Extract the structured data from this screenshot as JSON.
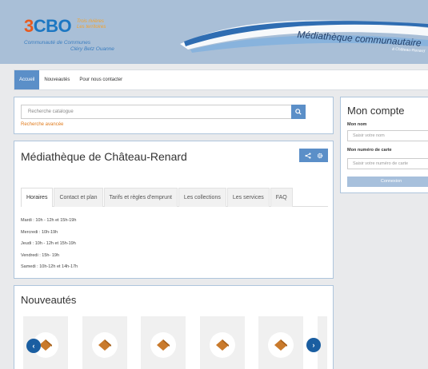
{
  "header": {
    "logo_prefix": "3",
    "logo_name": "CBO",
    "tagline_1": "Trois rivières",
    "tagline_2": "Les territoires",
    "community_1": "Communauté de Communes",
    "community_2": "Cléry Betz Ouanne",
    "site_title": "Médiathèque communautaire",
    "site_subtitle": "à Château-Renard"
  },
  "nav": {
    "items": [
      {
        "label": "Accueil",
        "active": true
      },
      {
        "label": "Nouveautés",
        "active": false
      },
      {
        "label": "Pour nous contacter",
        "active": false
      }
    ]
  },
  "search": {
    "placeholder": "Recherche catalogue",
    "advanced_link": "Recherche avancée"
  },
  "library": {
    "title": "Médiathèque de Château-Renard",
    "tabs": [
      {
        "label": "Horaires",
        "active": true
      },
      {
        "label": "Contact et plan",
        "active": false
      },
      {
        "label": "Tarifs et règles d'emprunt",
        "active": false
      },
      {
        "label": "Les collections",
        "active": false
      },
      {
        "label": "Les services",
        "active": false
      },
      {
        "label": "FAQ",
        "active": false
      }
    ],
    "hours": [
      "Mardi : 10h - 12h et 15h-19h",
      "Mercredi : 10h-19h",
      "Jeudi : 10h - 12h et 15h-19h",
      "Vendredi : 15h- 19h",
      "Samedi : 10h-12h et 14h-17h"
    ]
  },
  "news": {
    "title": "Nouveautés",
    "item_count": 5
  },
  "account": {
    "title": "Mon compte",
    "name_label": "Mon nom",
    "name_placeholder": "Saisir votre nom",
    "card_label": "Mon numéro de carte",
    "card_placeholder": "Saisir votre numéro de carte",
    "login_button": "Connexion"
  },
  "colors": {
    "accent": "#5b8fc8",
    "link_orange": "#e07b1d",
    "banner_blue": "#a9bfd7",
    "carousel_arrow": "#1a5ea1"
  }
}
